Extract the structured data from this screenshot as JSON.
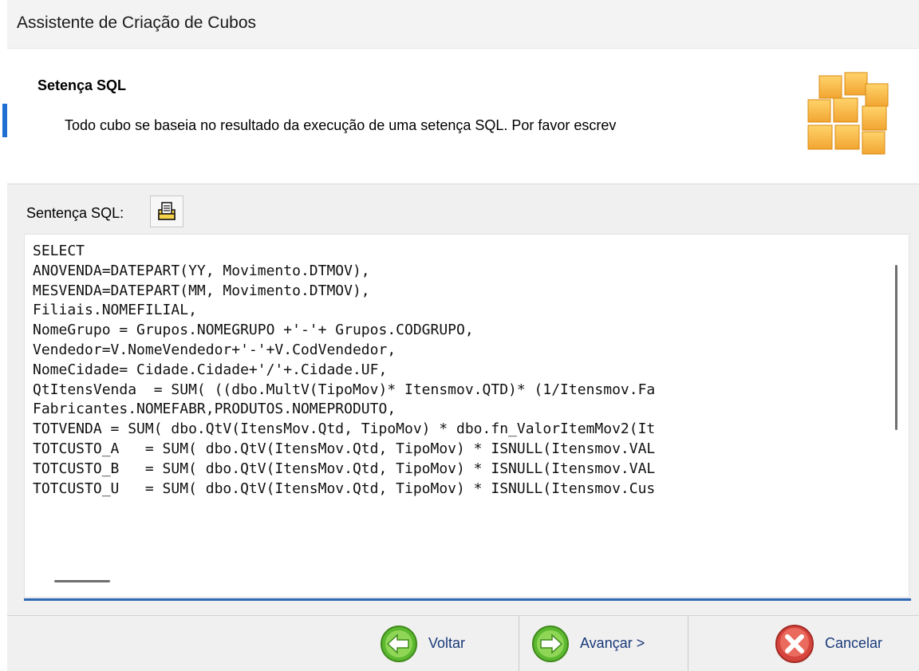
{
  "window": {
    "title": "Assistente de Criação de Cubos"
  },
  "header": {
    "heading": "Setença SQL",
    "description": "Todo cubo se baseia no resultado da execução de uma setença SQL. Por favor escrev"
  },
  "sql_section": {
    "label": "Sentença SQL:",
    "lines": [
      "SELECT",
      "ANOVENDA=DATEPART(YY, Movimento.DTMOV),",
      "MESVENDA=DATEPART(MM, Movimento.DTMOV),",
      "Filiais.NOMEFILIAL,",
      "NomeGrupo = Grupos.NOMEGRUPO +'-'+ Grupos.CODGRUPO,",
      "Vendedor=V.NomeVendedor+'-'+V.CodVendedor,",
      "NomeCidade= Cidade.Cidade+'/'+.Cidade.UF,",
      "QtItensVenda  = SUM( ((dbo.MultV(TipoMov)* Itensmov.QTD)* (1/Itensmov.Fa",
      "Fabricantes.NOMEFABR,PRODUTOS.NOMEPRODUTO,",
      "TOTVENDA = SUM( dbo.QtV(ItensMov.Qtd, TipoMov) * dbo.fn_ValorItemMov2(It",
      "TOTCUSTO_A   = SUM( dbo.QtV(ItensMov.Qtd, TipoMov) * ISNULL(Itensmov.VAL",
      "TOTCUSTO_B   = SUM( dbo.QtV(ItensMov.Qtd, TipoMov) * ISNULL(Itensmov.VAL",
      "TOTCUSTO_U   = SUM( dbo.QtV(ItensMov.Qtd, TipoMov) * ISNULL(Itensmov.Cus"
    ]
  },
  "footer": {
    "back_label": "Voltar",
    "next_label": "Avançar >",
    "cancel_label": "Cancelar"
  },
  "colors": {
    "accent_blue": "#2f68b4",
    "button_text": "#1a3a7a",
    "nav_green": "#5cb82e",
    "cancel_red": "#d6453d",
    "cube_orange": "#f2a531"
  },
  "icons": {
    "cubes": "cubes-icon",
    "paste": "paste-document-icon",
    "back": "green-arrow-left-icon",
    "next": "green-arrow-right-icon",
    "cancel": "red-x-icon"
  }
}
